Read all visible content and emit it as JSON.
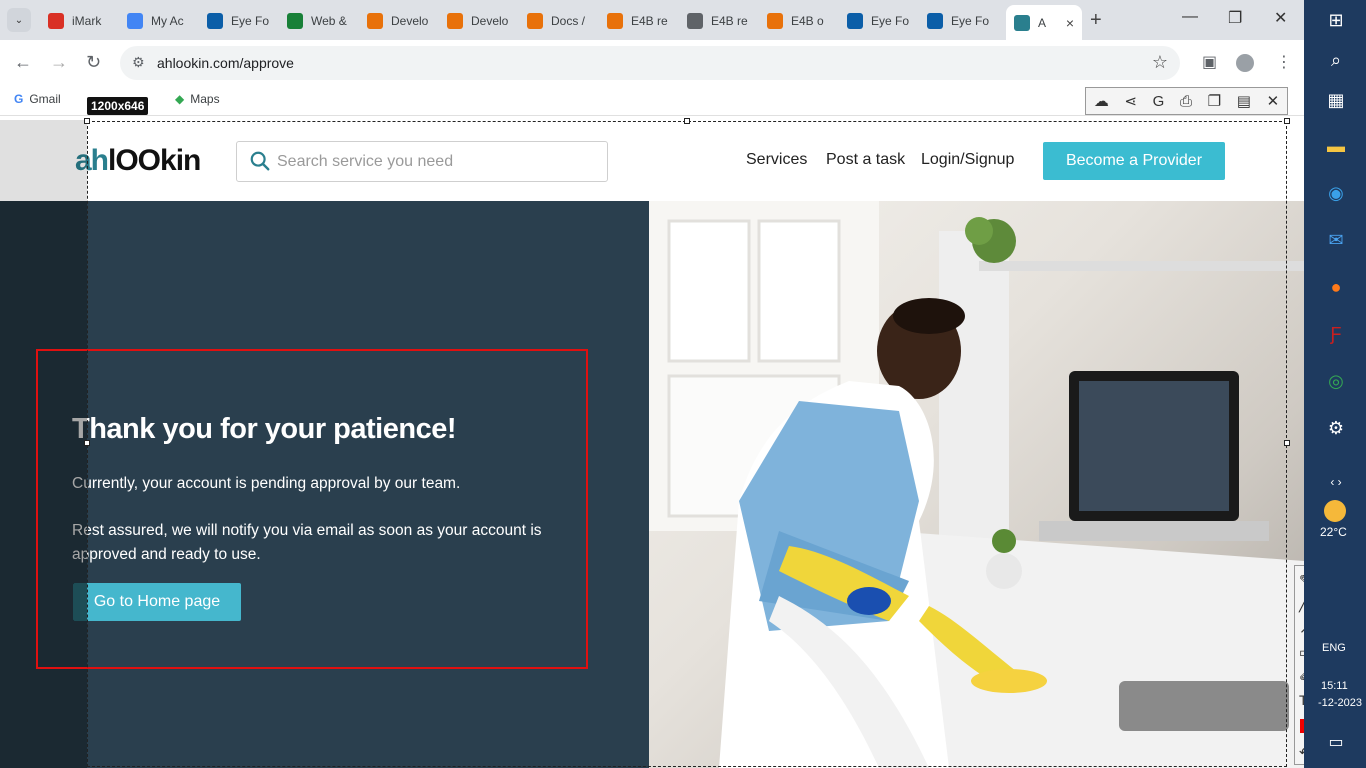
{
  "browser": {
    "tabs": [
      {
        "label": "iMark",
        "favicon": "gmail-icon",
        "color": "#d93025"
      },
      {
        "label": "My Ac",
        "favicon": "account-icon",
        "color": "#4285f4"
      },
      {
        "label": "Eye Fo",
        "favicon": "eye-icon",
        "color": "#0b5ea8"
      },
      {
        "label": "Web &",
        "favicon": "sheets-icon",
        "color": "#188038"
      },
      {
        "label": "Develo",
        "favicon": "app-icon",
        "color": "#e8710a"
      },
      {
        "label": "Develo",
        "favicon": "app-icon",
        "color": "#e8710a"
      },
      {
        "label": "Docs /",
        "favicon": "app-icon",
        "color": "#e8710a"
      },
      {
        "label": "E4B re",
        "favicon": "app-icon",
        "color": "#e8710a"
      },
      {
        "label": "E4B re",
        "favicon": "globe-icon",
        "color": "#5f6368"
      },
      {
        "label": "E4B o",
        "favicon": "app-icon",
        "color": "#e8710a"
      },
      {
        "label": "Eye Fo",
        "favicon": "eye-icon",
        "color": "#0b5ea8"
      },
      {
        "label": "Eye Fo",
        "favicon": "eye-icon",
        "color": "#0b5ea8"
      },
      {
        "label": "A",
        "favicon": "ahlookin-icon",
        "color": "#2a7f8e",
        "active": true
      }
    ],
    "url": "ahlookin.com/approve",
    "bookmarks": [
      {
        "label": "Gmail"
      },
      {
        "label": "Maps"
      }
    ]
  },
  "site": {
    "logo_ah": "ah",
    "logo_rest": "lOOkin",
    "search_placeholder": "Search service you need",
    "nav": {
      "services": "Services",
      "post_task": "Post a task",
      "login": "Login/Signup",
      "provider": "Become a Provider"
    },
    "hero": {
      "title": "Thank you for your patience!",
      "p1": "Currently, your account is pending approval by our team.",
      "p2": "Rest assured, we will notify you via email as soon as your account is approved and ready to use.",
      "button": "Go to Home page"
    }
  },
  "screenshot_tool": {
    "dimensions": "1200x646"
  },
  "taskbar": {
    "temperature": "22°C",
    "language": "ENG",
    "time": "15:11",
    "date": "-12-2023"
  },
  "colors": {
    "accent": "#3bbcd1",
    "hero_bg": "#2a3f4e",
    "annotation": "#e01010"
  }
}
